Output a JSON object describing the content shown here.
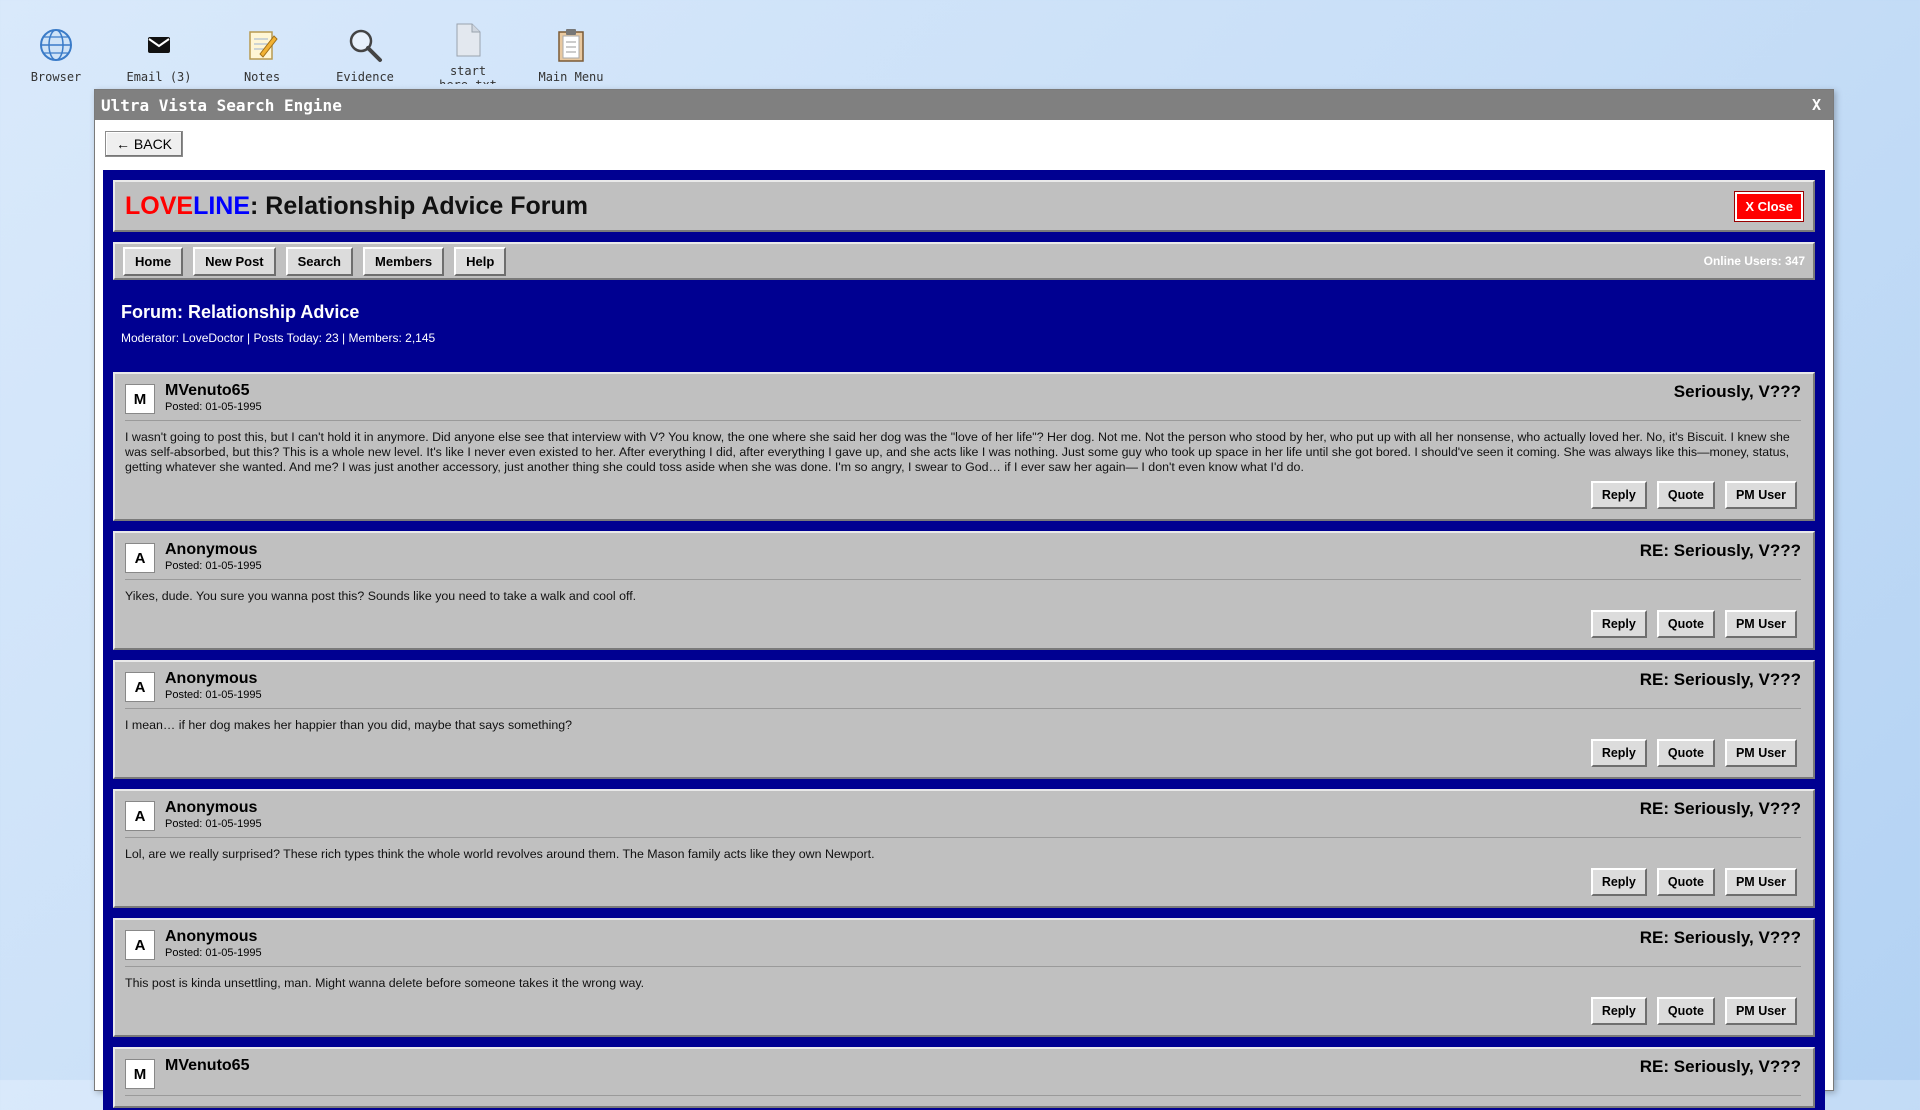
{
  "desktop": {
    "icons": [
      {
        "label": "Browser",
        "icon": "globe-icon"
      },
      {
        "label": "Email (3)",
        "icon": "envelope-icon"
      },
      {
        "label": "Notes",
        "icon": "notepad-icon"
      },
      {
        "label": "Evidence",
        "icon": "magnifier-icon"
      },
      {
        "label": "start here.txt",
        "icon": "document-icon"
      },
      {
        "label": "Main Menu",
        "icon": "clipboard-icon"
      }
    ]
  },
  "window": {
    "title": "Ultra Vista Search Engine",
    "close_label": "X",
    "back_label": "← BACK"
  },
  "forum": {
    "brand_love": "LOVE",
    "brand_line": "LINE",
    "title_suffix": ": Relationship Advice Forum",
    "close_label": "X Close",
    "nav": [
      "Home",
      "New Post",
      "Search",
      "Members",
      "Help"
    ],
    "online_users": "Online Users: 347",
    "name": "Forum: Relationship Advice",
    "meta": "Moderator: LoveDoctor | Posts Today: 23 | Members: 2,145",
    "colors": {
      "brand_love": "#ff0000",
      "brand_line": "#0000ff",
      "background": "#000091",
      "panel": "#c0c0c0"
    }
  },
  "actions": {
    "reply": "Reply",
    "quote": "Quote",
    "pm": "PM User"
  },
  "posts": [
    {
      "avatar": "M",
      "user": "MVenuto65",
      "posted": "Posted: 01-05-1995",
      "subject": "Seriously, V???",
      "body": "I wasn't going to post this, but I can't hold it in anymore. Did anyone else see that interview with V? You know, the one where she said her dog was the \"love of her life\"? Her dog. Not me. Not the person who stood by her, who put up with all her nonsense, who actually loved her. No, it's Biscuit. I knew she was self-absorbed, but this? This is a whole new level. It's like I never even existed to her. After everything I did, after everything I gave up, and she acts like I was nothing. Just some guy who took up space in her life until she got bored. I should've seen it coming. She was always like this—money, status, getting whatever she wanted. And me? I was just another accessory, just another thing she could toss aside when she was done. I'm so angry, I swear to God… if I ever saw her again— I don't even know what I'd do."
    },
    {
      "avatar": "A",
      "user": "Anonymous",
      "posted": "Posted: 01-05-1995",
      "subject": "RE: Seriously, V???",
      "body": "Yikes, dude. You sure you wanna post this? Sounds like you need to take a walk and cool off."
    },
    {
      "avatar": "A",
      "user": "Anonymous",
      "posted": "Posted: 01-05-1995",
      "subject": "RE: Seriously, V???",
      "body": "I mean… if her dog makes her happier than you did, maybe that says something?"
    },
    {
      "avatar": "A",
      "user": "Anonymous",
      "posted": "Posted: 01-05-1995",
      "subject": "RE: Seriously, V???",
      "body": "Lol, are we really surprised? These rich types think the whole world revolves around them. The Mason family acts like they own Newport."
    },
    {
      "avatar": "A",
      "user": "Anonymous",
      "posted": "Posted: 01-05-1995",
      "subject": "RE: Seriously, V???",
      "body": "This post is kinda unsettling, man. Might wanna delete before someone takes it the wrong way."
    },
    {
      "avatar": "M",
      "user": "MVenuto65",
      "posted": "",
      "subject": "RE: Seriously, V???",
      "body": ""
    }
  ]
}
